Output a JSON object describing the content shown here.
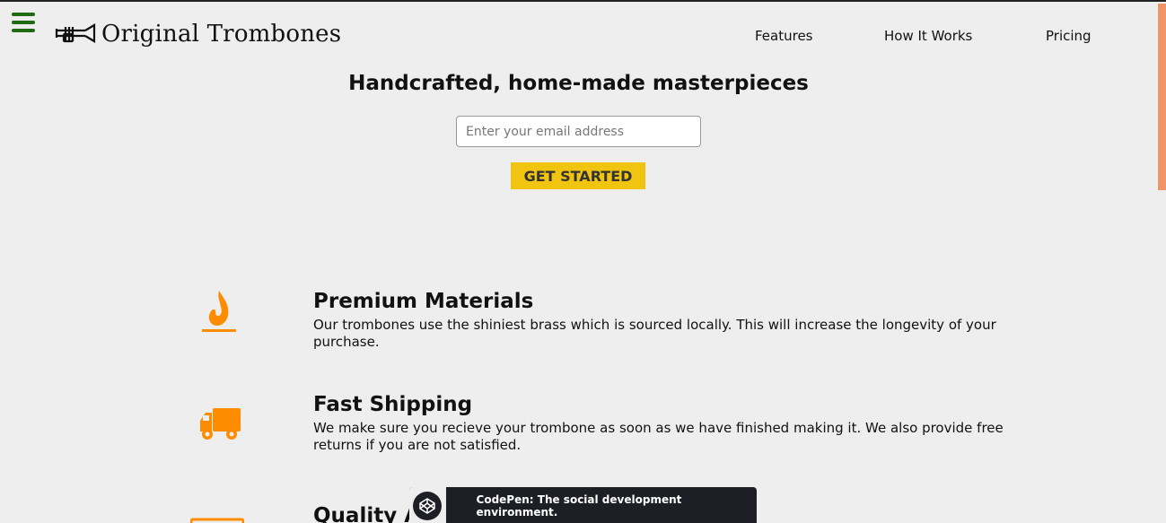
{
  "header": {
    "brand": "Original Trombones",
    "nav": [
      {
        "label": "Features"
      },
      {
        "label": "How It Works"
      },
      {
        "label": "Pricing"
      }
    ]
  },
  "hero": {
    "title": "Handcrafted, home-made masterpieces",
    "email_placeholder": "Enter your email address",
    "cta_label": "GET STARTED"
  },
  "features": [
    {
      "icon": "fire-icon",
      "title": "Premium Materials",
      "description": "Our trombones use the shiniest brass which is sourced locally. This will increase the longevity of your purchase."
    },
    {
      "icon": "truck-icon",
      "title": "Fast Shipping",
      "description": "We make sure you recieve your trombone as soon as we have finished making it. We also provide free returns if you are not satisfied."
    },
    {
      "icon": "battery-icon",
      "title": "Quality As",
      "description": ""
    }
  ],
  "codepen": {
    "text": "CodePen: The social development environment."
  },
  "colors": {
    "accent": "#f1c40f",
    "icon": "#ff8c00",
    "menu": "#1f6b12",
    "scrollbar": "#f0956a"
  }
}
